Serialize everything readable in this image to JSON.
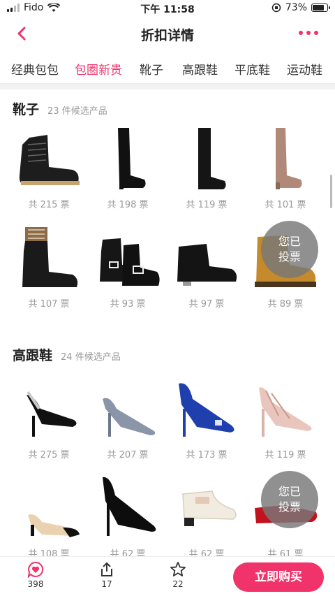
{
  "status_bar": {
    "carrier": "Fido",
    "time": "下午 11:58",
    "battery": "73%",
    "battery_level": 0.73
  },
  "header": {
    "title": "折扣详情",
    "back_icon": "chevron-left-icon",
    "more_icon": "more-dots-icon",
    "accent_color": "#f0336a"
  },
  "tabs": [
    {
      "label": "经典包包",
      "active": false
    },
    {
      "label": "包圈新贵",
      "active": true
    },
    {
      "label": "靴子",
      "active": false
    },
    {
      "label": "高跟鞋",
      "active": false
    },
    {
      "label": "平底鞋",
      "active": false
    },
    {
      "label": "运动鞋",
      "active": false
    }
  ],
  "sections": [
    {
      "name": "靴子",
      "count": "23 件候选产品",
      "products": [
        {
          "votes": "共 215 票",
          "icon": "combat-boot-icon",
          "voted": false
        },
        {
          "votes": "共 198 票",
          "icon": "over-knee-boot-icon",
          "voted": false
        },
        {
          "votes": "共 119 票",
          "icon": "over-knee-boot-icon",
          "voted": false
        },
        {
          "votes": "共 101 票",
          "icon": "over-knee-boot-icon",
          "voted": false
        },
        {
          "votes": "共 107 票",
          "icon": "sock-boot-icon",
          "voted": false
        },
        {
          "votes": "共 93 票",
          "icon": "chelsea-boot-icon",
          "voted": false
        },
        {
          "votes": "共 97 票",
          "icon": "ankle-boot-icon",
          "voted": false
        },
        {
          "votes": "共 89 票",
          "icon": "work-boot-icon",
          "voted": true
        }
      ]
    },
    {
      "name": "高跟鞋",
      "count": "24 件候选产品",
      "products": [
        {
          "votes": "共 275 票",
          "icon": "slingback-heel-icon",
          "voted": false
        },
        {
          "votes": "共 207 票",
          "icon": "glitter-pump-icon",
          "voted": false
        },
        {
          "votes": "共 173 票",
          "icon": "satin-pump-icon",
          "voted": false
        },
        {
          "votes": "共 119 票",
          "icon": "studded-heel-icon",
          "voted": false
        },
        {
          "votes": "共 108 票",
          "icon": "two-tone-slingback-icon",
          "voted": false
        },
        {
          "votes": "共 62 票",
          "icon": "patent-pump-icon",
          "voted": false
        },
        {
          "votes": "共 62 票",
          "icon": "bow-loafer-icon",
          "voted": false
        },
        {
          "votes": "共 61 票",
          "icon": "red-flat-icon",
          "voted": true
        }
      ]
    }
  ],
  "voted_badge": {
    "line1": "您已",
    "line2": "投票"
  },
  "bottom_bar": {
    "likes": "398",
    "shares": "17",
    "favorites": "22",
    "buy_label": "立即购买"
  }
}
